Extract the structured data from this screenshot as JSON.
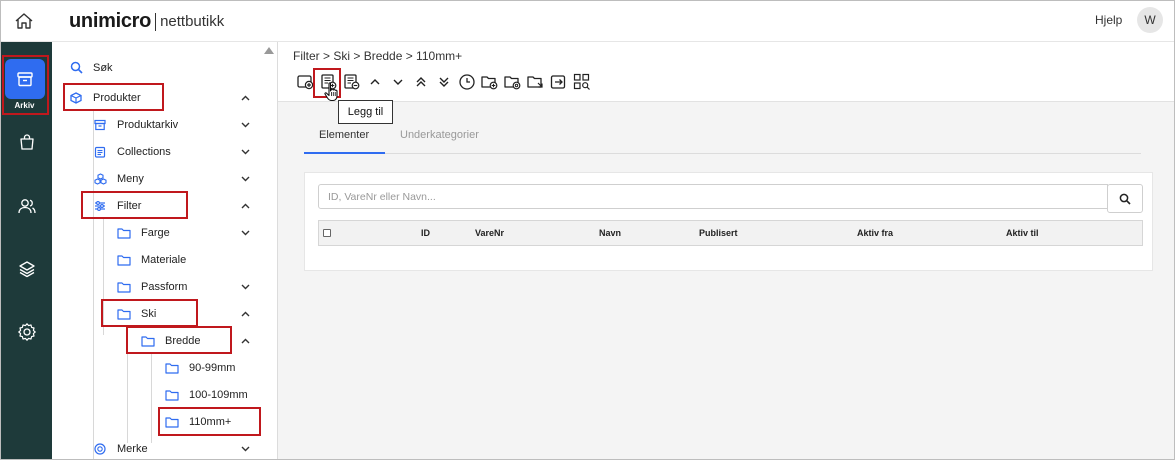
{
  "app": {
    "logo_main": "unimicro",
    "logo_sub": "nettbutikk"
  },
  "header": {
    "help_label": "Hjelp",
    "avatar_initial": "W"
  },
  "rail": {
    "active_label": "Arkiv",
    "items": [
      {
        "name": "home-icon"
      },
      {
        "name": "archive-icon",
        "label": "Arkiv",
        "active": true
      },
      {
        "name": "shopping-bag-icon"
      },
      {
        "name": "users-icon"
      },
      {
        "name": "layers-icon"
      },
      {
        "name": "gear-icon"
      }
    ]
  },
  "tree": {
    "items": [
      {
        "label": "Søk",
        "icon": "search-icon"
      },
      {
        "label": "Produkter",
        "icon": "cube-icon",
        "expanded": true
      },
      {
        "label": "Produktarkiv",
        "icon": "archive-icon",
        "expanded": false
      },
      {
        "label": "Collections",
        "icon": "clipboard-icon",
        "expanded": false
      },
      {
        "label": "Meny",
        "icon": "cubes-icon",
        "expanded": false
      },
      {
        "label": "Filter",
        "icon": "sliders-icon",
        "expanded": true
      },
      {
        "label": "Farge",
        "icon": "folder-icon",
        "expanded": false
      },
      {
        "label": "Materiale",
        "icon": "folder-icon"
      },
      {
        "label": "Passform",
        "icon": "folder-icon",
        "expanded": false
      },
      {
        "label": "Ski",
        "icon": "folder-icon",
        "expanded": true
      },
      {
        "label": "Bredde",
        "icon": "folder-icon",
        "expanded": true
      },
      {
        "label": "90-99mm",
        "icon": "folder-icon"
      },
      {
        "label": "100-109mm",
        "icon": "folder-icon"
      },
      {
        "label": "110mm+",
        "icon": "folder-icon",
        "selected": true
      },
      {
        "label": "Merke",
        "icon": "badge-icon",
        "expanded": false
      }
    ]
  },
  "main": {
    "breadcrumb": "Filter > Ski > Bredde > 110mm+",
    "tooltip": "Legg til",
    "toolbar": [
      "add-category-icon",
      "add-item-icon",
      "remove-item-icon",
      "chevron-up-icon",
      "chevron-down-icon",
      "double-chevron-up-icon",
      "double-chevron-down-icon",
      "clock-icon",
      "folder-add-icon",
      "folder-settings-icon",
      "folder-export-icon",
      "import-icon",
      "grid-search-icon"
    ],
    "tabs": [
      {
        "label": "Elementer",
        "active": true
      },
      {
        "label": "Underkategorier",
        "active": false
      }
    ],
    "search": {
      "placeholder": "ID, VareNr eller Navn...",
      "value": ""
    },
    "table": {
      "columns": [
        "ID",
        "VareNr",
        "Navn",
        "Publisert",
        "Aktiv fra",
        "Aktiv til"
      ],
      "rows": []
    }
  },
  "colors": {
    "rail_bg": "#1e3a3a",
    "accent": "#2f6cf0",
    "highlight": "#c0181d"
  }
}
